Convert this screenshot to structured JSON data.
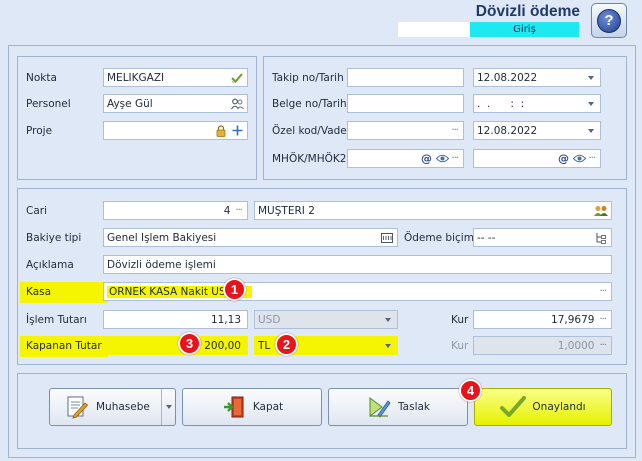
{
  "header": {
    "title": "Dövizli ödeme",
    "mode": "Giriş"
  },
  "colors": {
    "highlight": "#f5f500",
    "mode_badge": "#1ee8f2",
    "badge": "#e8131b",
    "title": "#1f3a6b"
  },
  "general": {
    "nokta_label": "Nokta",
    "nokta_value": "MELİKGAZİ",
    "personel_label": "Personel",
    "personel_value": "Ayşe Gül",
    "proje_label": "Proje",
    "proje_value": ""
  },
  "tracking": {
    "takip_label": "Takip no/Tarih",
    "takip_no": "",
    "takip_date": "12.08.2022",
    "belge_label": "Belge no/Tarih",
    "belge_no": "",
    "belge_date": ".  .      :  :",
    "ozel_label": "Özel kod/Vade",
    "ozel_kod": "",
    "vade_date": "12.08.2022",
    "mhok_label": "MHÖK/MHÖK2",
    "mhok1": "",
    "mhok2": ""
  },
  "payment": {
    "cari_label": "Cari",
    "cari_code": "4",
    "cari_name": "MÜŞTERİ 2",
    "bakiye_label": "Bakiye tipi",
    "bakiye_value": "Genel İşlem Bakiyesi",
    "odeme_label": "Ödeme biçimi",
    "odeme_value": "-- --",
    "aciklama_label": "Açıklama",
    "aciklama_value": "Dövizli ödeme işlemi",
    "kasa_label": "Kasa",
    "kasa_value": "ÖRNEK KASA Nakit USD",
    "islem_label": "İşlem Tutarı",
    "islem_value": "11,13",
    "islem_currency": "USD",
    "kur_label": "Kur",
    "kur_value": "17,9679",
    "kapanan_label": "Kapanan Tutar",
    "kapanan_value": "200,00",
    "kapanan_currency": "TL",
    "kur2_label": "Kur",
    "kur2_value": "1,0000"
  },
  "buttons": {
    "muhasebe": "Muhasebe",
    "kapat": "Kapat",
    "taslak": "Taslak",
    "onaylandi": "Onaylandı"
  },
  "badges": {
    "b1": "1",
    "b2": "2",
    "b3": "3",
    "b4": "4"
  },
  "icons": [
    "help-icon",
    "check-icon",
    "people-icon",
    "lock-icon",
    "plus-icon",
    "ellipsis-icon",
    "chevron-down-icon",
    "at-icon",
    "eye-icon",
    "cari-icon",
    "calculator-icon",
    "tree-icon",
    "notebook-icon",
    "door-icon",
    "draft-icon",
    "checkmark-icon"
  ]
}
